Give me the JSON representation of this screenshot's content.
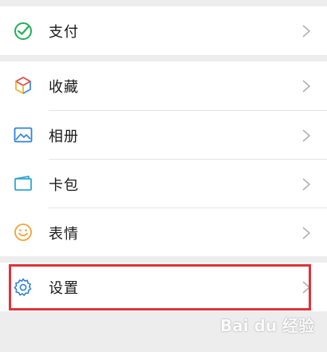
{
  "menu": {
    "pay": {
      "label": "支付",
      "icon": "pay-icon"
    },
    "favorites": {
      "label": "收藏",
      "icon": "favorites-cube-icon"
    },
    "album": {
      "label": "相册",
      "icon": "album-image-icon"
    },
    "cards": {
      "label": "卡包",
      "icon": "card-wallet-icon"
    },
    "stickers": {
      "label": "表情",
      "icon": "smiley-icon"
    },
    "settings": {
      "label": "设置",
      "icon": "gear-icon"
    }
  },
  "colors": {
    "highlight": "#e0323a",
    "pay_green": "#21b15a",
    "settings_blue": "#2f83d8",
    "sticker_orange": "#f2a43a"
  },
  "watermark": {
    "text": "Bai du 经验"
  }
}
